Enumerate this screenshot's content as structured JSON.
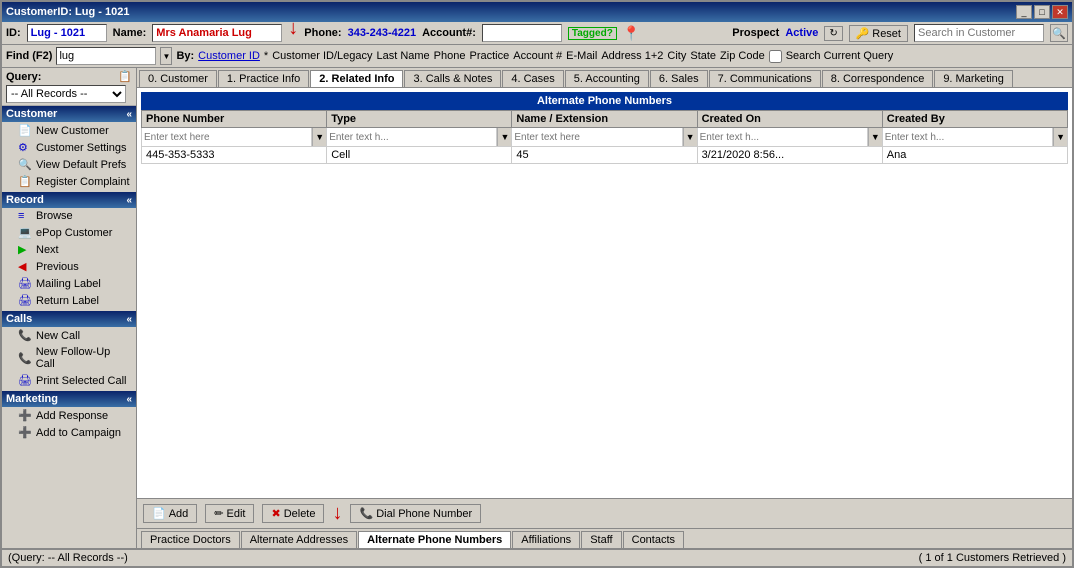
{
  "window": {
    "title": "CustomerID: Lug - 1021"
  },
  "topbar": {
    "id_label": "ID:",
    "id_value": "Lug - 1021",
    "name_label": "Name:",
    "name_value": "Mrs Anamaria Lug",
    "phone_label": "Phone:",
    "phone_value": "343-243-4221",
    "account_label": "Account#:",
    "account_value": "",
    "tagged_label": "Tagged?",
    "prospect_label": "Prospect",
    "active_label": "Active",
    "reset_label": "Reset",
    "search_placeholder": "Search in Customer"
  },
  "findbar": {
    "find_label": "Find (F2)",
    "find_value": "lug",
    "by_label": "By:",
    "by_options": [
      "Customer ID",
      "Customer ID/Legacy",
      "Last Name",
      "Phone",
      "Practice",
      "Account #",
      "E-Mail",
      "Address 1+2",
      "City",
      "State",
      "Zip Code"
    ],
    "by_selected": "Customer ID",
    "search_current_query": "Search Current Query",
    "nav_items": [
      "* Customer ID/Legacy",
      "Last Name",
      "Phone",
      "Practice",
      "Account #",
      "E-Mail",
      "Address 1+2",
      "City",
      "State",
      "Zip Code"
    ]
  },
  "query": {
    "label": "Query:",
    "selected": "-- All Records --"
  },
  "sidebar": {
    "customer_section": "Customer",
    "customer_items": [
      {
        "label": "New Customer",
        "icon": "📄"
      },
      {
        "label": "Customer Settings",
        "icon": "⚙"
      },
      {
        "label": "View Default Prefs",
        "icon": "🔍"
      },
      {
        "label": "Register Complaint",
        "icon": "📋"
      }
    ],
    "record_section": "Record",
    "record_items": [
      {
        "label": "Browse",
        "icon": "≡"
      },
      {
        "label": "ePop Customer",
        "icon": "💻"
      },
      {
        "label": "Next",
        "icon": "▶"
      },
      {
        "label": "Previous",
        "icon": "◀"
      },
      {
        "label": "Mailing Label",
        "icon": "🖨"
      },
      {
        "label": "Return Label",
        "icon": "🖨"
      }
    ],
    "calls_section": "Calls",
    "calls_items": [
      {
        "label": "New Call",
        "icon": "📞"
      },
      {
        "label": "New Follow-Up Call",
        "icon": "📞"
      },
      {
        "label": "Print Selected Call",
        "icon": "🖨"
      }
    ],
    "marketing_section": "Marketing",
    "marketing_items": [
      {
        "label": "Add Response",
        "icon": "➕"
      },
      {
        "label": "Add to Campaign",
        "icon": "➕"
      }
    ]
  },
  "tabs": [
    {
      "label": "0. Customer"
    },
    {
      "label": "1. Practice Info"
    },
    {
      "label": "2. Related Info",
      "active": true
    },
    {
      "label": "3. Calls & Notes"
    },
    {
      "label": "4. Cases"
    },
    {
      "label": "5. Accounting"
    },
    {
      "label": "6. Sales"
    },
    {
      "label": "7. Communications"
    },
    {
      "label": "8. Correspondence"
    },
    {
      "label": "9. Marketing"
    }
  ],
  "table": {
    "section_title": "Alternate Phone Numbers",
    "columns": [
      "Phone Number",
      "Type",
      "Name / Extension",
      "Created On",
      "Created By"
    ],
    "filter_placeholders": [
      "Enter text here",
      "Enter text h...",
      "Enter text here",
      "Enter text h...",
      "Enter text h..."
    ],
    "rows": [
      {
        "phone": "445-353-5333",
        "type": "Cell",
        "name_ext": "45",
        "created_on": "3/21/2020 8:56...",
        "created_by": "Ana"
      }
    ]
  },
  "action_buttons": [
    {
      "label": "Add",
      "icon": "📄"
    },
    {
      "label": "Edit",
      "icon": "✏"
    },
    {
      "label": "Delete",
      "icon": "✖"
    },
    {
      "label": "Dial Phone Number",
      "icon": "📞"
    }
  ],
  "sub_tabs": [
    {
      "label": "Practice Doctors"
    },
    {
      "label": "Alternate Addresses"
    },
    {
      "label": "Alternate Phone Numbers",
      "active": true
    },
    {
      "label": "Affiliations"
    },
    {
      "label": "Staff"
    },
    {
      "label": "Contacts"
    }
  ],
  "statusbar": {
    "left": "(Query: -- All Records --)",
    "right": "( 1 of 1 Customers Retrieved )"
  }
}
